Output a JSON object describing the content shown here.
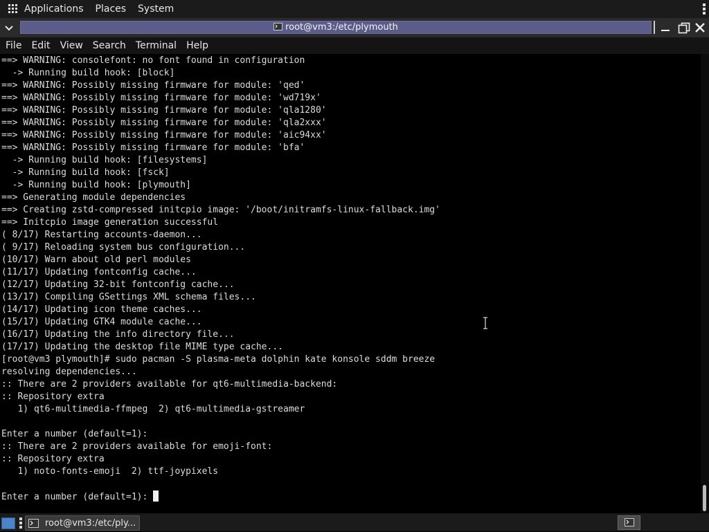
{
  "top_panel": {
    "menus": [
      "Applications",
      "Places",
      "System"
    ]
  },
  "window": {
    "title": "root@vm3:/etc/plymouth"
  },
  "menubar": {
    "items": [
      "File",
      "Edit",
      "View",
      "Search",
      "Terminal",
      "Help"
    ]
  },
  "terminal": {
    "lines": [
      "==> WARNING: consolefont: no font found in configuration",
      "  -> Running build hook: [block]",
      "==> WARNING: Possibly missing firmware for module: 'qed'",
      "==> WARNING: Possibly missing firmware for module: 'wd719x'",
      "==> WARNING: Possibly missing firmware for module: 'qla1280'",
      "==> WARNING: Possibly missing firmware for module: 'qla2xxx'",
      "==> WARNING: Possibly missing firmware for module: 'aic94xx'",
      "==> WARNING: Possibly missing firmware for module: 'bfa'",
      "  -> Running build hook: [filesystems]",
      "  -> Running build hook: [fsck]",
      "  -> Running build hook: [plymouth]",
      "==> Generating module dependencies",
      "==> Creating zstd-compressed initcpio image: '/boot/initramfs-linux-fallback.img'",
      "==> Initcpio image generation successful",
      "( 8/17) Restarting accounts-daemon...",
      "( 9/17) Reloading system bus configuration...",
      "(10/17) Warn about old perl modules",
      "(11/17) Updating fontconfig cache...",
      "(12/17) Updating 32-bit fontconfig cache...",
      "(13/17) Compiling GSettings XML schema files...",
      "(14/17) Updating icon theme caches...",
      "(15/17) Updating GTK4 module cache...",
      "(16/17) Updating the info directory file...",
      "(17/17) Updating the desktop file MIME type cache...",
      "[root@vm3 plymouth]# sudo pacman -S plasma-meta dolphin kate konsole sddm breeze",
      "resolving dependencies...",
      ":: There are 2 providers available for qt6-multimedia-backend:",
      ":: Repository extra",
      "   1) qt6-multimedia-ffmpeg  2) qt6-multimedia-gstreamer",
      "",
      "Enter a number (default=1):",
      ":: There are 2 providers available for emoji-font:",
      ":: Repository extra",
      "   1) noto-fonts-emoji  2) ttf-joypixels",
      ""
    ],
    "prompt": "Enter a number (default=1): "
  },
  "taskbar": {
    "task_label": "root@vm3:/etc/ply..."
  }
}
